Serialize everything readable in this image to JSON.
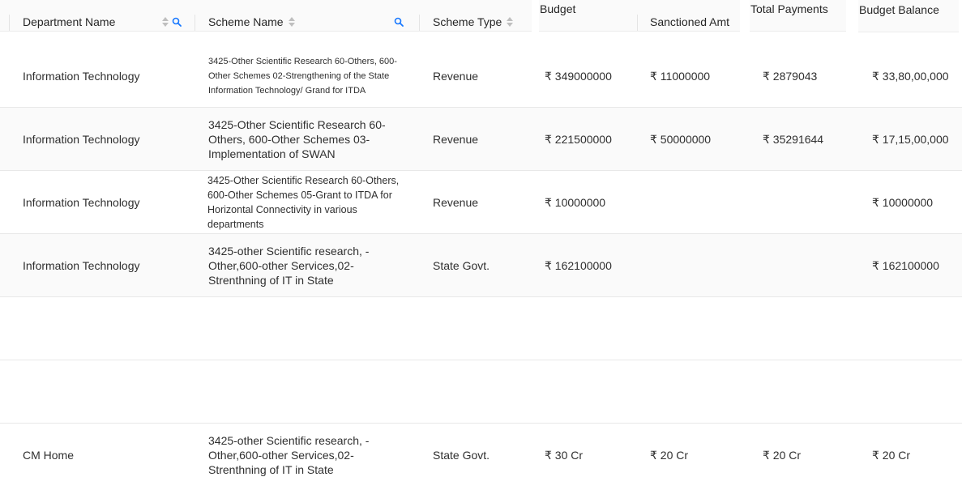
{
  "columns": {
    "department": "Department Name",
    "scheme_name": "Scheme Name",
    "scheme_type": "Scheme Type",
    "budget": "Budget",
    "sanctioned": "Sanctioned Amt",
    "total_payments": "Total Payments",
    "budget_balance": "Budget Balance"
  },
  "rows": [
    {
      "department": "Information Technology",
      "scheme_name": "3425-Other Scientific Research 60-Others, 600-Other Schemes 02-Strengthening of the State Information Technology/ Grand for ITDA",
      "scheme_type": "Revenue",
      "budget": "₹ 349000000",
      "sanctioned": "₹ 11000000",
      "total_payments": "₹ 2879043",
      "budget_balance": "₹ 33,80,00,000"
    },
    {
      "department": "Information Technology",
      "scheme_name": "3425-Other Scientific Research 60-Others, 600-Other Schemes 03-Implementation of SWAN",
      "scheme_type": "Revenue",
      "budget": "₹ 221500000",
      "sanctioned": "₹ 50000000",
      "total_payments": "₹ 35291644",
      "budget_balance": "₹ 17,15,00,000"
    },
    {
      "department": "Information Technology",
      "scheme_name": "3425-Other Scientific Research 60-Others, 600-Other Schemes 05-Grant to ITDA for Horizontal Connectivity in various departments",
      "scheme_type": "Revenue",
      "budget": "₹ 10000000",
      "sanctioned": "",
      "total_payments": "",
      "budget_balance": "₹ 10000000"
    },
    {
      "department": "Information Technology",
      "scheme_name": "3425-other Scientific research, -Other,600-other Services,02-Strenthning of IT in State",
      "scheme_type": "State Govt.",
      "budget": "₹ 162100000",
      "sanctioned": "",
      "total_payments": "",
      "budget_balance": "₹ 162100000"
    },
    {
      "department": "",
      "scheme_name": "",
      "scheme_type": "",
      "budget": "",
      "sanctioned": "",
      "total_payments": "",
      "budget_balance": ""
    },
    {
      "department": "",
      "scheme_name": "",
      "scheme_type": "",
      "budget": "",
      "sanctioned": "",
      "total_payments": "",
      "budget_balance": ""
    },
    {
      "department": "CM Home",
      "scheme_name": "3425-other Scientific research, -Other,600-other Services,02-Strenthning of IT in State",
      "scheme_type": "State Govt.",
      "budget": "₹ 30 Cr",
      "sanctioned": "₹ 20 Cr",
      "total_payments": "₹ 20 Cr",
      "budget_balance": "₹ 20 Cr"
    }
  ]
}
